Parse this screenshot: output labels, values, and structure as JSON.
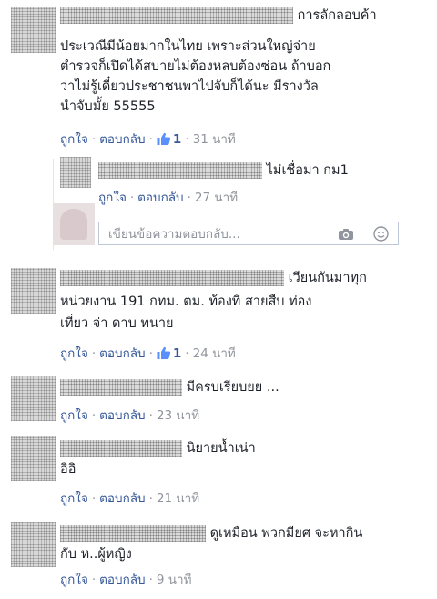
{
  "actions": {
    "like": "ถูกใจ",
    "reply": "ตอบกลับ",
    "separator": "·"
  },
  "reply_input": {
    "placeholder": "เขียนข้อความตอบกลับ..."
  },
  "comments": [
    {
      "line1": "การลักลอบค้า",
      "lines": [
        "ประเวณีมีน้อยมากในไทย เพราะส่วนใหญ่จ่าย",
        "ตำรวจก็เปิดได้สบายไม่ต้องหลบต้องซ่อน ถ้าบอก",
        "ว่าไม่รู้เดี๋ยวประชาชนพาไปจับก็ได้นะ มีรางวัล",
        "นำจับมั้ย 55555"
      ],
      "likes": "1",
      "time": "31 นาที"
    },
    {
      "line1": "ไม่เชื่อมา กม1",
      "time": "27 นาที"
    },
    {
      "line1": "เวียนกันมาทุก",
      "lines": [
        "หน่วยงาน 191 กทม. ตม. ท้องที่ สายสืบ ท่อง",
        "เที่ยว จ่า ดาบ ทนาย"
      ],
      "likes": "1",
      "time": "24 นาที"
    },
    {
      "line1": "มีครบเรียบยย ...",
      "time": "23 นาที"
    },
    {
      "line1": "นิยายน้ำเน่า",
      "lines": [
        "อิอิ"
      ],
      "time": "21 นาที"
    },
    {
      "line1": "ดูเหมือน พวกมียศ จะหากิน",
      "lines": [
        "กับ ห..ผู้หญิง"
      ],
      "time": "9 นาที"
    }
  ],
  "colors": {
    "link": "#365899",
    "meta": "#90949c",
    "text": "#1d2129"
  }
}
